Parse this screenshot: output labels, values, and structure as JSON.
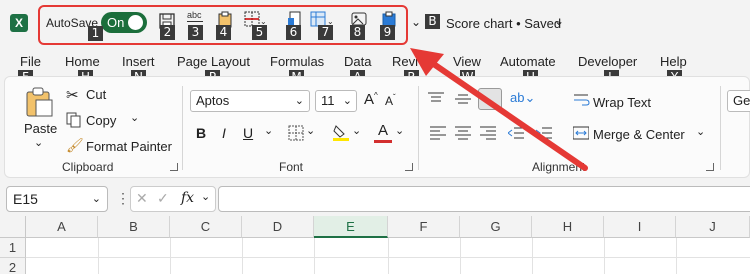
{
  "qat": {
    "autosave_label": "AutoSave",
    "toggle_state": "On",
    "keytips": [
      "1",
      "2",
      "3",
      "4",
      "5",
      "6",
      "7",
      "8",
      "9"
    ],
    "file_keytip": "B",
    "doc_title": "Score chart • Saved"
  },
  "tabs": [
    {
      "label": "File",
      "keytip": "F"
    },
    {
      "label": "Home",
      "keytip": "H"
    },
    {
      "label": "Insert",
      "keytip": "N"
    },
    {
      "label": "Page Layout",
      "keytip": "P"
    },
    {
      "label": "Formulas",
      "keytip": "M"
    },
    {
      "label": "Data",
      "keytip": "A"
    },
    {
      "label": "Revi",
      "keytip": "R"
    },
    {
      "label": "View",
      "keytip": "W"
    },
    {
      "label": "Automate",
      "keytip": "U"
    },
    {
      "label": "Developer",
      "keytip": "L"
    },
    {
      "label": "Help",
      "keytip": "Y"
    }
  ],
  "ribbon": {
    "clipboard": {
      "paste": "Paste",
      "cut": "Cut",
      "copy": "Copy",
      "format_painter": "Format Painter",
      "label": "Clipboard"
    },
    "font": {
      "font_name": "Aptos",
      "font_size": "11",
      "bold": "B",
      "italic": "I",
      "underline": "U",
      "font_color": "A",
      "label": "Font"
    },
    "alignment": {
      "wrap_text": "Wrap Text",
      "merge_center": "Merge & Center",
      "label": "Alignment"
    },
    "number": {
      "format": "Gen"
    }
  },
  "formula_bar": {
    "name_box": "E15",
    "fx": "fx"
  },
  "sheet": {
    "columns": [
      "A",
      "B",
      "C",
      "D",
      "E",
      "F",
      "G",
      "H",
      "I",
      "J"
    ],
    "selected_column": "E",
    "rows": [
      "1",
      "2"
    ]
  },
  "colors": {
    "accent_green": "#1b6e3b",
    "annotation_red": "#e53935"
  }
}
